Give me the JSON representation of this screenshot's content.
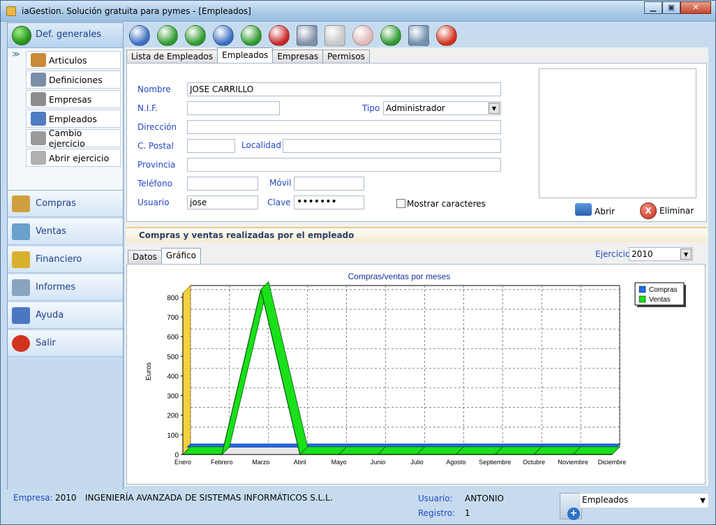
{
  "window": {
    "title": "iaGestion. Solución gratuita para pymes - [Empleados]",
    "btn_min": "▁",
    "btn_max": "▣",
    "btn_close": "✕"
  },
  "sidebar": {
    "header": "Def. generales",
    "chev": "≫",
    "sub_items": [
      {
        "label": "Articulos",
        "icon": "boxes-icon",
        "color": "#c98a3a"
      },
      {
        "label": "Definiciones",
        "icon": "document-icon",
        "color": "#7a8ea8"
      },
      {
        "label": "Empresas",
        "icon": "building-icon",
        "color": "#8c8c8c"
      },
      {
        "label": "Empleados",
        "icon": "users-icon",
        "color": "#4f7cc2"
      },
      {
        "label": "Cambio ejercicio",
        "icon": "clock-icon",
        "color": "#9a9a9a"
      },
      {
        "label": "Abrir ejercicio",
        "icon": "calendar-icon",
        "color": "#b0b0b0"
      }
    ],
    "menu": [
      {
        "label": "Compras",
        "icon": "truck-icon",
        "color": "#d0a040"
      },
      {
        "label": "Ventas",
        "icon": "invoice-icon",
        "color": "#6aa0cc"
      },
      {
        "label": "Financiero",
        "icon": "coins-icon",
        "color": "#d8b030"
      },
      {
        "label": "Informes",
        "icon": "report-icon",
        "color": "#8aa4c0"
      },
      {
        "label": "Ayuda",
        "icon": "help-icon",
        "color": "#4a78c0"
      },
      {
        "label": "Salir",
        "icon": "power-icon",
        "color": "#d2321e"
      }
    ]
  },
  "toolbar": [
    {
      "icon": "first-icon",
      "color": "#3d6fc4"
    },
    {
      "icon": "previous-icon",
      "color": "#2e9a2e"
    },
    {
      "icon": "next-icon",
      "color": "#2e9a2e"
    },
    {
      "icon": "last-icon",
      "color": "#3d6fc4"
    },
    {
      "icon": "add-icon",
      "color": "#2e9a2e"
    },
    {
      "icon": "delete-icon",
      "color": "#c82828"
    },
    {
      "icon": "edit-icon",
      "color": "#8090a8"
    },
    {
      "icon": "save-icon",
      "color": "#c8c8c8"
    },
    {
      "icon": "cancel-icon",
      "color": "#e0b8b8"
    },
    {
      "icon": "refresh-icon",
      "color": "#2e9a2e"
    },
    {
      "icon": "search-icon",
      "color": "#7090b0"
    },
    {
      "icon": "power-icon",
      "color": "#d2321e"
    }
  ],
  "tabs": [
    "Lista de Empleados",
    "Empleados",
    "Empresas",
    "Permisos"
  ],
  "form": {
    "nombre_label": "Nombre",
    "nombre": "JOSE CARRILLO",
    "nif_label": "N.I.F.",
    "nif": "",
    "tipo_label": "Tipo",
    "tipo": "Administrador",
    "direccion_label": "Dirección",
    "direccion": "",
    "cpostal_label": "C. Postal",
    "cpostal": "",
    "localidad_label": "Localidad",
    "localidad": "",
    "provincia_label": "Provincia",
    "provincia": "",
    "telefono_label": "Teléfono",
    "telefono": "",
    "movil_label": "Móvil",
    "movil": "",
    "usuario_label": "Usuario",
    "usuario": "jose",
    "clave_label": "Clave",
    "clave": "•••••••",
    "mostrar": "Mostrar caracteres",
    "abrir": "Abrir",
    "eliminar": "Eliminar"
  },
  "section_title": "Compras y ventas realizadas por el empleado",
  "subtabs": [
    "Datos",
    "Gráfico"
  ],
  "ejercicio_label": "Ejercicio",
  "ejercicio": "2010",
  "colors": {
    "compras": "#1f6fe8",
    "ventas": "#19e019",
    "wall": "#f4d23c"
  },
  "chart_data": {
    "type": "line",
    "title": "Compras/ventas por meses",
    "ylabel": "Euros",
    "xlabel": "",
    "categories": [
      "Enero",
      "Febrero",
      "Marzo",
      "Abril",
      "Mayo",
      "Junio",
      "Julio",
      "Agosto",
      "Septiembre",
      "Octubre",
      "Noviembre",
      "Diciembre"
    ],
    "series": [
      {
        "name": "Compras",
        "values": [
          0,
          0,
          0,
          0,
          0,
          0,
          0,
          0,
          0,
          0,
          0,
          0
        ]
      },
      {
        "name": "Ventas",
        "values": [
          0,
          0,
          840,
          0,
          0,
          0,
          0,
          0,
          0,
          0,
          0,
          0
        ]
      }
    ],
    "ylim": [
      0,
      800
    ],
    "yticks": [
      0,
      100,
      200,
      300,
      400,
      500,
      600,
      700,
      800
    ],
    "grid": true,
    "legend": "top-right",
    "style": "3d"
  },
  "status": {
    "empresa_label": "Empresa:",
    "empresa_code": "2010",
    "empresa_name": "INGENIERÍA AVANZADA DE SISTEMAS INFORMÁTICOS S.L.L.",
    "usuario_label": "Usuario:",
    "usuario": "ANTONIO",
    "registro_label": "Registro:",
    "registro": "1",
    "module": "Empleados"
  }
}
